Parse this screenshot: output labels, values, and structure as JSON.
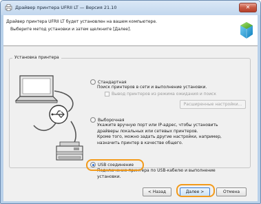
{
  "window": {
    "title": "Драйвер принтера UFRII LT — Версия 21.10",
    "close_label": "✕"
  },
  "header": {
    "line1": "Драйвер принтера UFRII LT будет установлен на вашем компьютере.",
    "line2": "Выберите метод установки и затем щелкните [Далее].",
    "icon": "installer-disk-icon"
  },
  "group": {
    "legend": "Установка принтера"
  },
  "options": {
    "standard": {
      "label": "Стандартная",
      "desc": [
        "Поиск принтеров в сети и выполнение установки."
      ],
      "checkbox_label": "Вывод принтеров из режима ожидания и поиск",
      "advanced_button": "Расширенные настройки...",
      "selected": false
    },
    "custom": {
      "label": "Выборочная",
      "desc": [
        "Укажите вручную порт или IP-адрес, чтобы установить",
        "драйверы локальных или сетевых принтеров.",
        "Кроме того, можно задать другие настройки, например,",
        "назначить принтер в качестве общего."
      ],
      "selected": false
    },
    "usb": {
      "label": "USB соединение",
      "desc": [
        "Подключение принтера по USB-кабелю и выполнение",
        "установки."
      ],
      "selected": true
    }
  },
  "buttons": {
    "back": "< Назад",
    "next": "Далее >",
    "cancel": "Отмена"
  },
  "colors": {
    "highlight": "#f29a1a",
    "accent": "#2a6bd1",
    "title_bar": "#c8dcf1"
  }
}
